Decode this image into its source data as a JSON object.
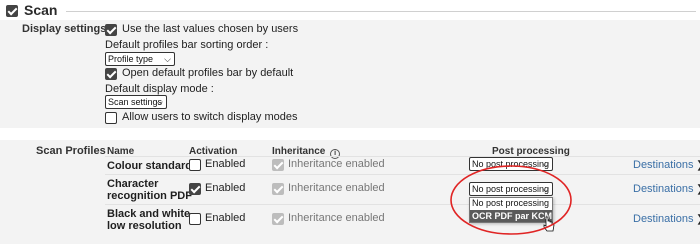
{
  "section": {
    "title": "Scan",
    "checked": true
  },
  "display_settings": {
    "label": "Display settings",
    "use_last_values": {
      "label": "Use the last values chosen by users",
      "checked": true
    },
    "sorting_order": {
      "label": "Default profiles bar sorting order :",
      "value": "Profile type"
    },
    "open_default": {
      "label": "Open default profiles bar by default",
      "checked": true
    },
    "display_mode": {
      "label": "Default display mode :",
      "value": "Scan settings"
    },
    "allow_switch": {
      "label": "Allow users to switch display modes",
      "checked": false
    }
  },
  "scan_profiles": {
    "label": "Scan Profiles",
    "columns": {
      "name": "Name",
      "activation": "Activation",
      "inheritance": "Inheritance",
      "post": "Post processing"
    },
    "rows": [
      {
        "name": "Colour standard",
        "enabled_label": "Enabled",
        "enabled": false,
        "inheritance_label": "Inheritance enabled",
        "post": "No post processing",
        "dest": "Destinations"
      },
      {
        "name_line1": "Character",
        "name_line2": "recognition PDF",
        "enabled_label": "Enabled",
        "enabled": true,
        "inheritance_label": "Inheritance enabled",
        "post": "No post processing",
        "dest": "Destinations"
      },
      {
        "name_line1": "Black and white",
        "name_line2": "low resolution",
        "enabled_label": "Enabled",
        "enabled": false,
        "inheritance_label": "Inheritance enabled",
        "dest": "Destinations"
      }
    ],
    "dropdown_options": [
      "No post processing",
      "OCR PDF par KCM"
    ],
    "highlight_color": "#e02424"
  }
}
